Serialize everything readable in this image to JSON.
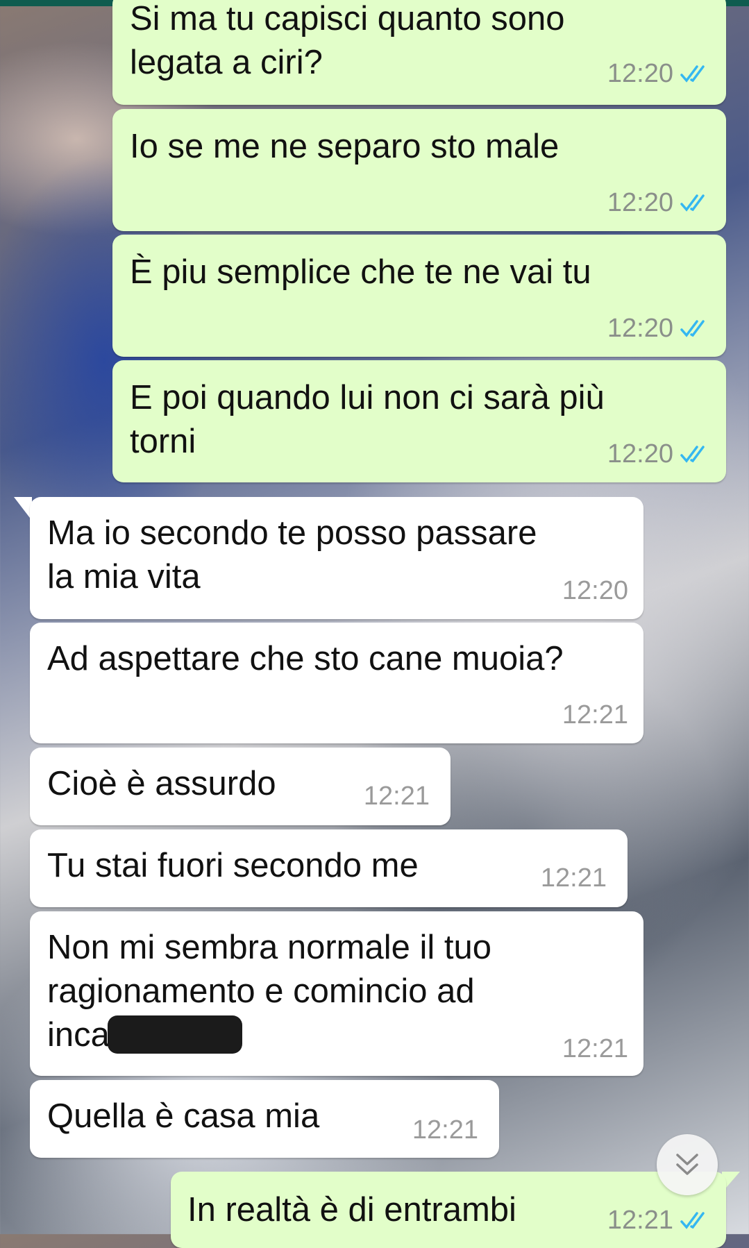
{
  "messages": [
    {
      "dir": "out",
      "text": "Si ma tu capisci quanto sono\nlegata a ciri?",
      "time": "12:20",
      "status": "read"
    },
    {
      "dir": "out",
      "text": "Io se me ne separo sto male",
      "time": "12:20",
      "status": "read"
    },
    {
      "dir": "out",
      "text": "È piu semplice che te ne vai tu",
      "time": "12:20",
      "status": "read"
    },
    {
      "dir": "out",
      "text": "E poi quando lui non ci sarà più\ntorni",
      "time": "12:20",
      "status": "read"
    },
    {
      "dir": "in",
      "text": "Ma io secondo te posso passare\nla mia vita",
      "time": "12:20"
    },
    {
      "dir": "in",
      "text": "Ad aspettare che sto cane muoia?",
      "time": "12:21"
    },
    {
      "dir": "in",
      "text": "Cioè è assurdo",
      "time": "12:21"
    },
    {
      "dir": "in",
      "text": "Tu stai fuori secondo me",
      "time": "12:21"
    },
    {
      "dir": "in",
      "text": "Non mi sembra normale il tuo\nragionamento e comincio ad\ninca",
      "time": "12:21"
    },
    {
      "dir": "in",
      "text": "Quella è casa mia",
      "time": "12:21"
    },
    {
      "dir": "out",
      "text": "In realtà è di entrambi",
      "time": "12:21",
      "status": "read"
    }
  ],
  "colors": {
    "outgoing": "#e2fec9",
    "incoming": "#ffffff",
    "read_ticks": "#34b7f1",
    "header": "#0f5c4f"
  },
  "icons": {
    "read_status": "double-check-icon",
    "scroll": "chevron-double-down-icon"
  }
}
